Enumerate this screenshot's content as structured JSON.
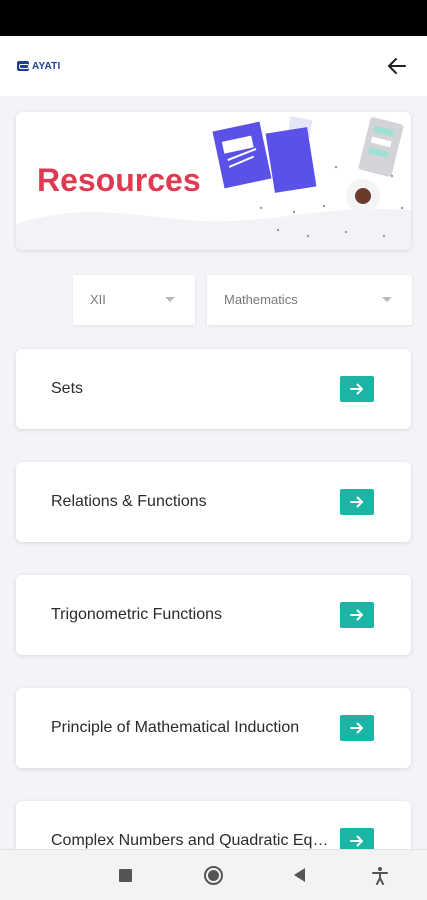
{
  "app": {
    "logo_text": "AYATI"
  },
  "hero": {
    "title": "Resources",
    "accent_color": "#e03a53"
  },
  "filters": {
    "class_value": "XII",
    "subject_value": "Mathematics"
  },
  "chapters": [
    {
      "label": "Sets"
    },
    {
      "label": "Relations & Functions"
    },
    {
      "label": "Trigonometric Functions"
    },
    {
      "label": "Principle of Mathematical Induction"
    },
    {
      "label": "Complex Numbers and Quadratic Equations"
    }
  ],
  "icons": {
    "back": "arrow-left-icon",
    "chapter_action": "arrow-right-icon",
    "nav_recents": "square-icon",
    "nav_home": "circle-icon",
    "nav_back": "triangle-back-icon",
    "nav_accessibility": "accessibility-icon"
  },
  "colors": {
    "action_button": "#1cb4a4",
    "background": "#f3f4f8",
    "logo": "#1f3f8f"
  }
}
